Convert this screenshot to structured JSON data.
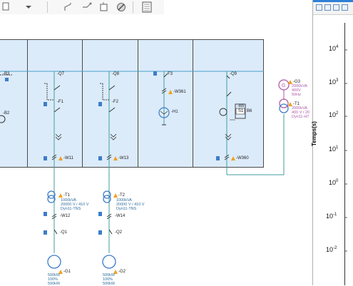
{
  "diagram": {
    "top_labels": {
      "b3": "-B3",
      "b2": "-B2"
    },
    "feeders": [
      {
        "breaker": "-Q7",
        "fuse": "-F1",
        "cable": "-W11"
      },
      {
        "breaker": "-Q8",
        "fuse": "-F2",
        "cable": "-W13"
      },
      {
        "breaker": "-F3",
        "cable": "-W361",
        "load": "-H1"
      },
      {
        "breaker": "-Q9",
        "relay": "S1",
        "relay_code": "B6",
        "cable": "-W360",
        "fuse": "-B5"
      }
    ],
    "transformers": [
      {
        "id": "-T1",
        "lines": [
          "1000kVA",
          "20000 V / 410 V",
          "Dyn11-TNS"
        ],
        "cable": "-W12",
        "breaker": "-Q1",
        "gen": "-G1",
        "gen_lines": [
          "500kW",
          "100%",
          "500kW"
        ]
      },
      {
        "id": "-T2",
        "lines": [
          "1000kVA",
          "20000 V / 410 V",
          "Dyn11-TNS"
        ],
        "cable": "-W14",
        "breaker": "-Q2",
        "gen": "-G2",
        "gen_lines": [
          "500kW",
          "100%",
          "500kW"
        ]
      }
    ],
    "source": {
      "gen_id": "-G3",
      "gen_lines": [
        "2000kVA",
        "400V",
        "50Hz"
      ],
      "tr_id": "-T1",
      "tr_lines": [
        "2000kVA",
        "400 V / 20",
        "Dyn11-HT"
      ]
    }
  },
  "chart": {
    "ylabel": "Temps(s)",
    "ticks": [
      {
        "base": "10",
        "exp": "4"
      },
      {
        "base": "10",
        "exp": "3"
      },
      {
        "base": "10",
        "exp": "2"
      },
      {
        "base": "10",
        "exp": "1"
      },
      {
        "base": "10",
        "exp": "0"
      },
      {
        "base": "10",
        "exp": "-1"
      },
      {
        "base": "10",
        "exp": "-2"
      }
    ]
  },
  "colors": {
    "board": "#dcebfa",
    "wire": "#3f9fa0",
    "warn": "#f0a020",
    "device": "#3d7cc9",
    "source": "#b05aa8"
  }
}
